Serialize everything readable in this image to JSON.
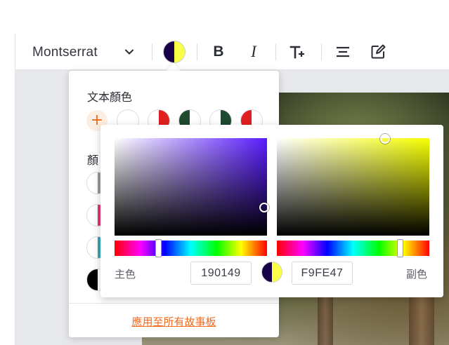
{
  "toolbar": {
    "font_family_value": "Montserrat",
    "current_colors": {
      "primary": "#190149",
      "secondary": "#F9FE47"
    },
    "icons": [
      "chevron-down-icon",
      "bold-icon",
      "italic-icon",
      "text-size-icon",
      "align-center-icon",
      "edit-icon"
    ],
    "bold_glyph": "B",
    "italic_glyph": "I"
  },
  "color_panel": {
    "text_color_title": "文本顏色",
    "add_glyph": "+",
    "section2_title_partial": "顏",
    "apply_all_label": "應用至所有故事板",
    "text_color_swatches": [
      {
        "left": "#ffffff",
        "right": "#ffffff"
      },
      {
        "left": "#ffffff",
        "right": "#e02020"
      },
      {
        "left": "#1e4a2e",
        "right": "#ffffff"
      },
      {
        "left": "#ffffff",
        "right": "#1e4a2e"
      },
      {
        "left": "#e02020",
        "right": "#ffffff"
      }
    ],
    "palette_swatches": [
      {
        "left": "#ffffff",
        "right": "#9a9a9a"
      },
      {
        "left": "#ffffff",
        "right": "#e8336b"
      },
      {
        "left": "#ffffff",
        "right": "#35a8b8"
      },
      {
        "left": "#000000",
        "right": "#ffffff"
      }
    ]
  },
  "color_picker": {
    "primary_label": "主色",
    "primary_hex": "190149",
    "primary_hue_color": "#5a1dff",
    "secondary_label": "副色",
    "secondary_hex": "F9FE47",
    "secondary_hue_color": "#f6ff00"
  }
}
